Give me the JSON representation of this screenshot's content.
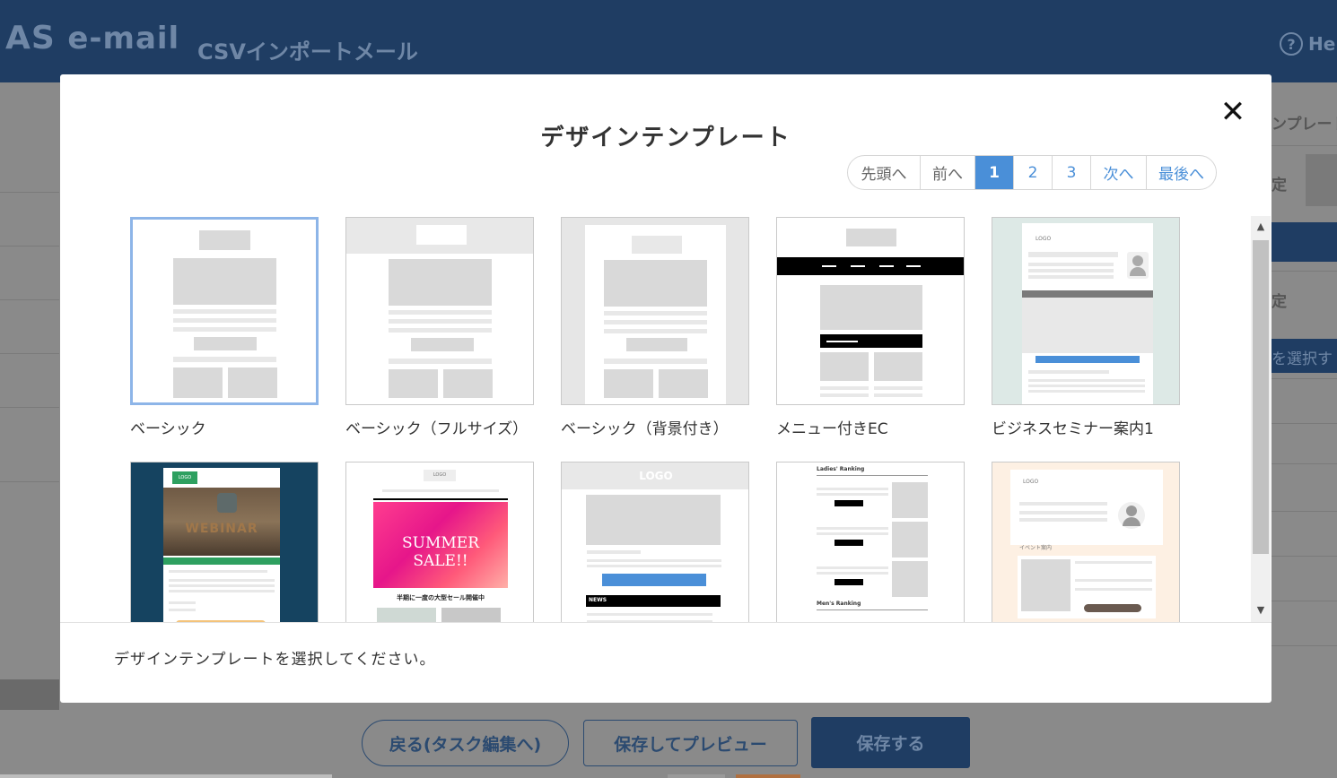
{
  "app": {
    "logo": "AS",
    "logo_suffix": "e-mail",
    "page_title": "CSVインポートメール",
    "help_label": "He",
    "help_icon": "question-circle-icon"
  },
  "background_right": {
    "item1": "ンプレート",
    "item2": "定",
    "item3": "定",
    "item4": "を選択す"
  },
  "bottom_buttons": {
    "back_label": "戻る(タスク編集へ)",
    "preview_label": "保存してプレビュー",
    "save_label": "保存する"
  },
  "modal": {
    "title": "デザインテンプレート",
    "close_icon": "close-icon",
    "footer_message": "デザインテンプレートを選択してください。",
    "pagination": {
      "first": "先頭へ",
      "prev": "前へ",
      "pages": [
        "1",
        "2",
        "3"
      ],
      "current_page": "1",
      "next": "次へ",
      "last": "最後へ"
    },
    "templates": [
      {
        "label": "ベーシック",
        "selected": true
      },
      {
        "label": "ベーシック（フルサイズ）",
        "selected": false
      },
      {
        "label": "ベーシック（背景付き）",
        "selected": false
      },
      {
        "label": "メニュー付きEC",
        "selected": false
      },
      {
        "label": "ビジネスセミナー案内1",
        "selected": false
      },
      {
        "label": "",
        "selected": false
      },
      {
        "label": "",
        "selected": false
      },
      {
        "label": "",
        "selected": false
      },
      {
        "label": "",
        "selected": false
      },
      {
        "label": "",
        "selected": false
      }
    ],
    "thumbnail_text": {
      "logo": "LOGO",
      "webinar": "WEBINAR",
      "summer_sale": "SUMMER SALE!!",
      "summer_caption": "半期に一度の大型セール開催中",
      "ladies_ranking": "Ladies' Ranking",
      "mens_ranking": "Men's Ranking",
      "news": "NEWS",
      "event": "イベント案内"
    }
  },
  "colors": {
    "header_bg": "#1f3d63",
    "accent_blue": "#4a8fd8",
    "selected_border": "#8db5e8"
  }
}
